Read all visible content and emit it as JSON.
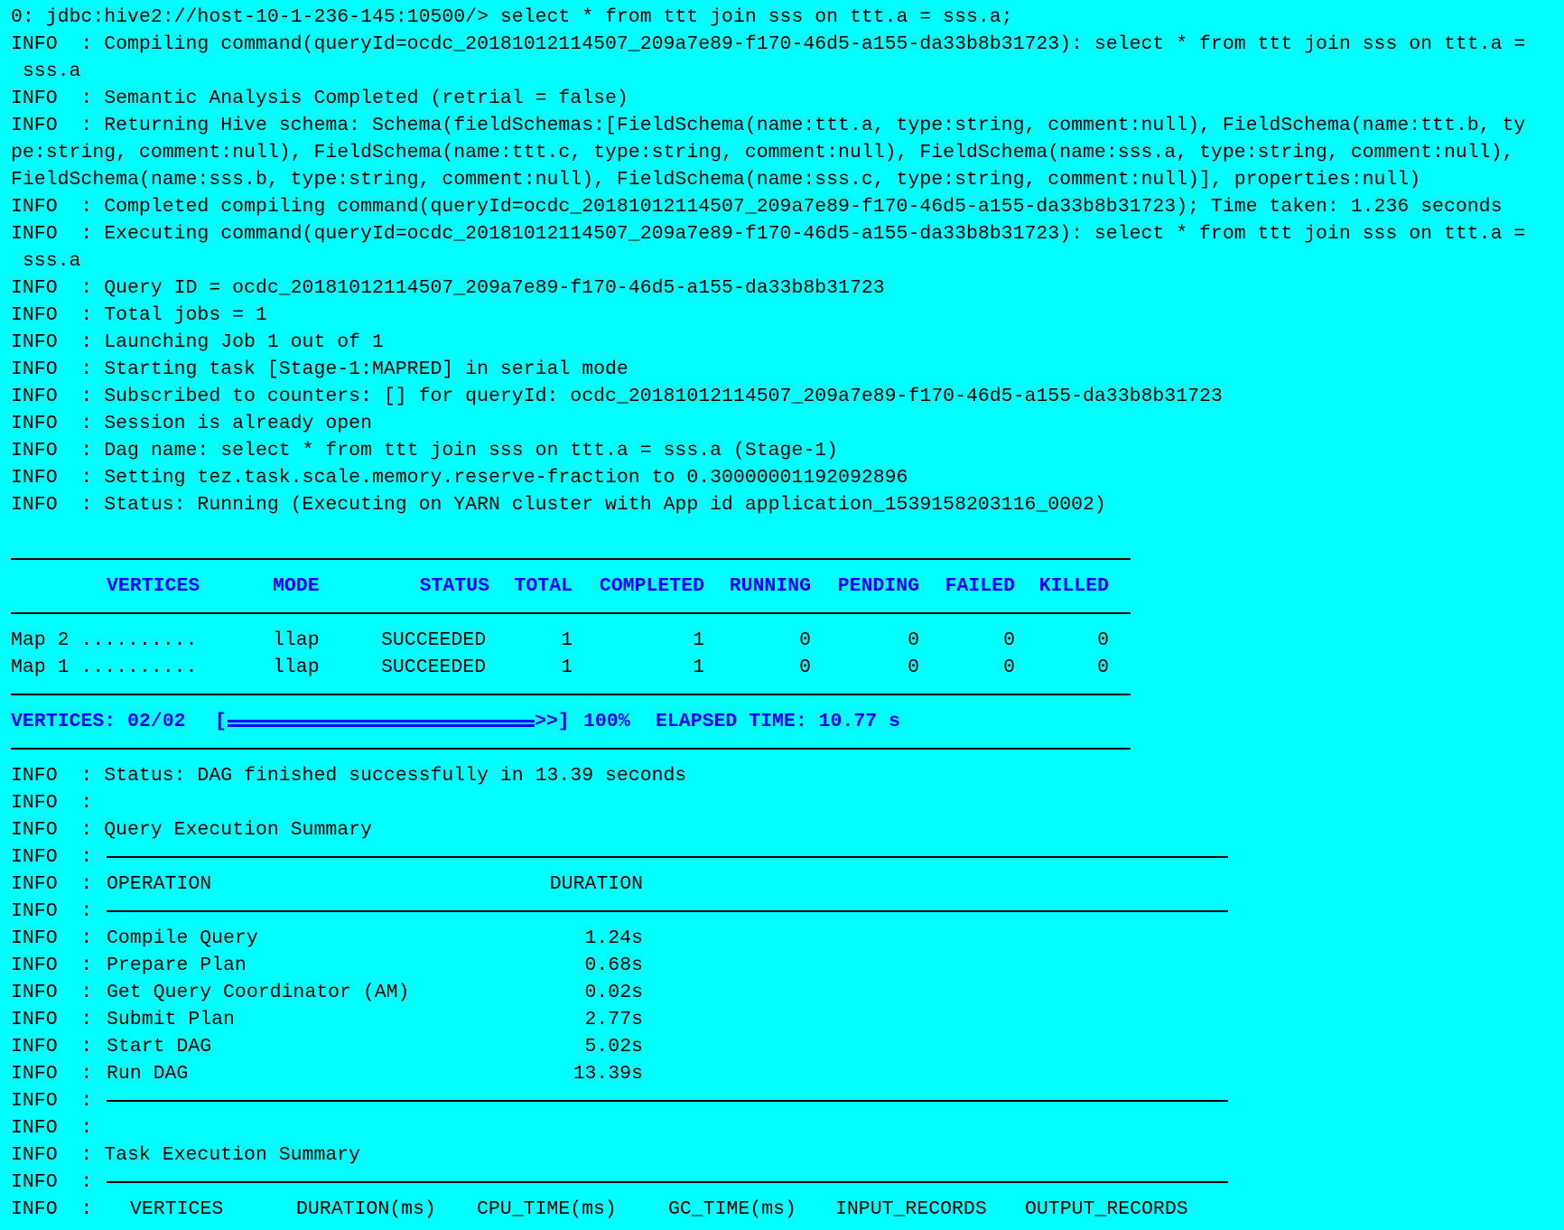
{
  "terminal": {
    "prompt_line": "0: jdbc:hive2://host-10-1-236-145:10500/> select * from ttt join sss on ttt.a = sss.a;",
    "log_lines_top": [
      "INFO  : Compiling command(queryId=ocdc_20181012114507_209a7e89-f170-46d5-a155-da33b8b31723): select * from ttt join sss on ttt.a =",
      " sss.a",
      "INFO  : Semantic Analysis Completed (retrial = false)",
      "INFO  : Returning Hive schema: Schema(fieldSchemas:[FieldSchema(name:ttt.a, type:string, comment:null), FieldSchema(name:ttt.b, ty",
      "pe:string, comment:null), FieldSchema(name:ttt.c, type:string, comment:null), FieldSchema(name:sss.a, type:string, comment:null),",
      "FieldSchema(name:sss.b, type:string, comment:null), FieldSchema(name:sss.c, type:string, comment:null)], properties:null)",
      "INFO  : Completed compiling command(queryId=ocdc_20181012114507_209a7e89-f170-46d5-a155-da33b8b31723); Time taken: 1.236 seconds",
      "INFO  : Executing command(queryId=ocdc_20181012114507_209a7e89-f170-46d5-a155-da33b8b31723): select * from ttt join sss on ttt.a =",
      " sss.a",
      "INFO  : Query ID = ocdc_20181012114507_209a7e89-f170-46d5-a155-da33b8b31723",
      "INFO  : Total jobs = 1",
      "INFO  : Launching Job 1 out of 1",
      "INFO  : Starting task [Stage-1:MAPRED] in serial mode",
      "INFO  : Subscribed to counters: [] for queryId: ocdc_20181012114507_209a7e89-f170-46d5-a155-da33b8b31723",
      "INFO  : Session is already open",
      "INFO  : Dag name: select * from ttt join sss on ttt.a = sss.a (Stage-1)",
      "INFO  : Setting tez.task.scale.memory.reserve-fraction to 0.30000001192092896",
      "INFO  : Status: Running (Executing on YARN cluster with App id application_1539158203116_0002)"
    ],
    "vertex_table": {
      "headers": [
        "VERTICES",
        "MODE",
        "STATUS",
        "TOTAL",
        "COMPLETED",
        "RUNNING",
        "PENDING",
        "FAILED",
        "KILLED"
      ],
      "rows": [
        [
          "Map 2 ..........",
          "llap",
          "SUCCEEDED",
          "1",
          "1",
          "0",
          "0",
          "0",
          "0"
        ],
        [
          "Map 1 ..........",
          "llap",
          "SUCCEEDED",
          "1",
          "1",
          "0",
          "0",
          "0",
          "0"
        ]
      ]
    },
    "progress": {
      "vertices_label": "VERTICES: 02/02",
      "bar_open": "[",
      "bar_close": ">>]",
      "percent_text": "100%",
      "percent_value": 100,
      "elapsed_label": "ELAPSED TIME: 10.77 s"
    },
    "log_lines_mid": [
      "INFO  : Status: DAG finished successfully in 13.39 seconds",
      "INFO  :",
      "INFO  : Query Execution Summary"
    ],
    "info_prefix": "INFO  :",
    "query_summary": {
      "headers": [
        "OPERATION",
        "DURATION"
      ],
      "rows": [
        [
          "Compile Query",
          "1.24s"
        ],
        [
          "Prepare Plan",
          "0.68s"
        ],
        [
          "Get Query Coordinator (AM)",
          "0.02s"
        ],
        [
          "Submit Plan",
          "2.77s"
        ],
        [
          "Start DAG",
          "5.02s"
        ],
        [
          "Run DAG",
          "13.39s"
        ]
      ]
    },
    "log_lines_after_summary": [
      "INFO  :",
      "INFO  : Task Execution Summary"
    ],
    "task_summary_headers": [
      "VERTICES",
      "DURATION(ms)",
      "CPU_TIME(ms)",
      "GC_TIME(ms)",
      "INPUT_RECORDS",
      "OUTPUT_RECORDS"
    ],
    "colors": {
      "background": "#00ffff",
      "text": "#000000",
      "accent": "#0000ff"
    }
  }
}
